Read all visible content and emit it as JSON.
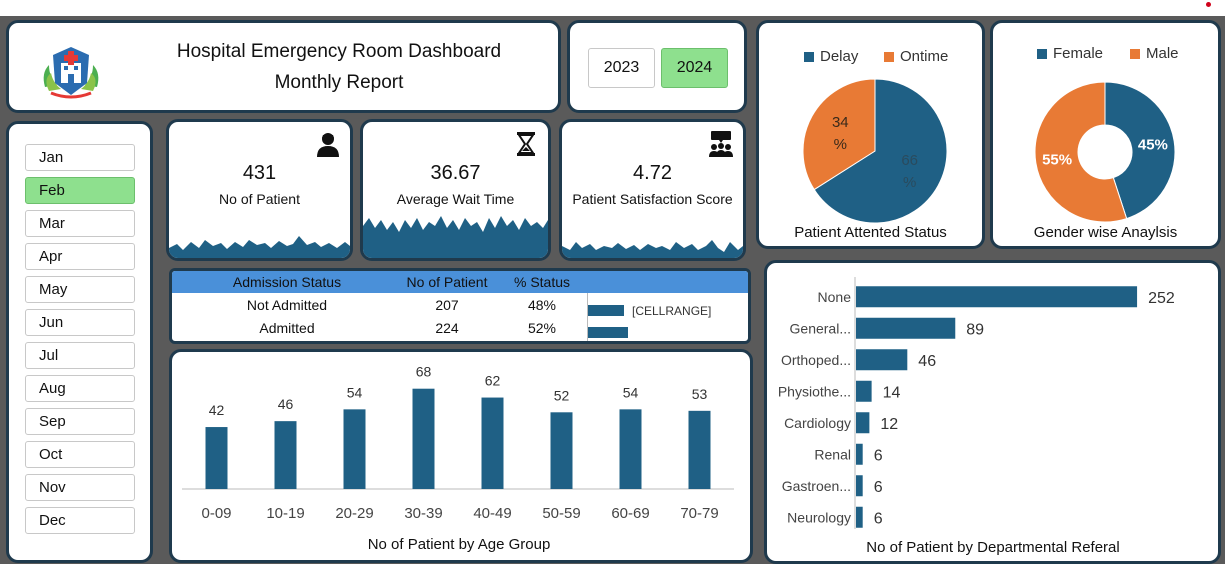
{
  "header": {
    "title_line1": "Hospital Emergency Room Dashboard",
    "title_line2": "Monthly Report"
  },
  "years": [
    {
      "label": "2023",
      "selected": false
    },
    {
      "label": "2024",
      "selected": true
    }
  ],
  "months": [
    {
      "label": "Jan",
      "selected": false
    },
    {
      "label": "Feb",
      "selected": true
    },
    {
      "label": "Mar",
      "selected": false
    },
    {
      "label": "Apr",
      "selected": false
    },
    {
      "label": "May",
      "selected": false
    },
    {
      "label": "Jun",
      "selected": false
    },
    {
      "label": "Jul",
      "selected": false
    },
    {
      "label": "Aug",
      "selected": false
    },
    {
      "label": "Sep",
      "selected": false
    },
    {
      "label": "Oct",
      "selected": false
    },
    {
      "label": "Nov",
      "selected": false
    },
    {
      "label": "Dec",
      "selected": false
    }
  ],
  "kpis": [
    {
      "value": "431",
      "label": "No of Patient",
      "icon": "patient-icon"
    },
    {
      "value": "36.67",
      "label": "Average Wait Time",
      "icon": "hourglass-icon"
    },
    {
      "value": "4.72",
      "label": "Patient Satisfaction Score",
      "icon": "group-feedback-icon"
    }
  ],
  "admission": {
    "headers": [
      "Admission Status",
      "No of Patient",
      "% Status"
    ],
    "rows": [
      {
        "status": "Not Admitted",
        "count": "207",
        "pct": "48%",
        "fraction": 0.48
      },
      {
        "status": "Admitted",
        "count": "224",
        "pct": "52%",
        "fraction": 0.52
      }
    ],
    "bar_label": "[CELLRANGE]"
  },
  "colors": {
    "primary": "#1f6085",
    "orange": "#e87a35",
    "green_selected": "#8ee08e",
    "border": "#1f3a4d",
    "table_header": "#4a90d9"
  },
  "chart_data": [
    {
      "type": "bar",
      "title": "No of Patient by Age Group",
      "categories": [
        "0-09",
        "10-19",
        "20-29",
        "30-39",
        "40-49",
        "50-59",
        "60-69",
        "70-79"
      ],
      "values": [
        42,
        46,
        54,
        68,
        62,
        52,
        54,
        53
      ],
      "ylim": [
        0,
        80
      ],
      "grid": false
    },
    {
      "type": "pie",
      "title": "Patient  Attented Status",
      "categories": [
        "Delay",
        "Ontime"
      ],
      "values": [
        66,
        34
      ],
      "labels": [
        "66\n%",
        "34\n%"
      ],
      "legend": "top"
    },
    {
      "type": "pie",
      "title": "Gender wise Anaylsis",
      "categories": [
        "Female",
        "Male"
      ],
      "values": [
        45,
        55
      ],
      "labels": [
        "45%",
        "55%"
      ],
      "legend": "top"
    },
    {
      "type": "bar",
      "orientation": "horizontal",
      "title": "No of Patient by Departmental Referal",
      "categories": [
        "None",
        "General...",
        "Orthoped...",
        "Physiothe...",
        "Cardiology",
        "Renal",
        "Gastroen...",
        "Neurology"
      ],
      "values": [
        252,
        89,
        46,
        14,
        12,
        6,
        6,
        6
      ],
      "xlim": [
        0,
        260
      ]
    }
  ]
}
